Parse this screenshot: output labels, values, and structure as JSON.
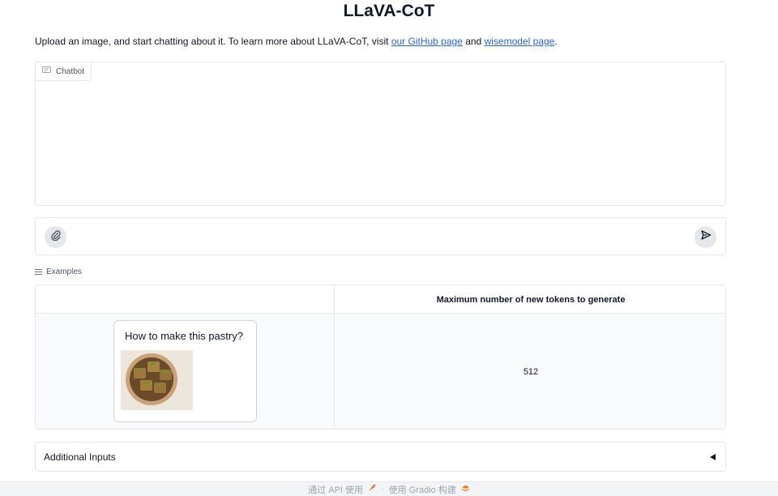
{
  "header": {
    "title": "LLaVA-CoT",
    "description_prefix": "Upload an image, and start chatting about it. To learn more about LLaVA-CoT, visit ",
    "link_github": "our GitHub page",
    "description_mid": " and ",
    "link_wisemodel": "wisemodel page",
    "description_suffix": "."
  },
  "chatbot": {
    "label": "Chatbot",
    "icon": "chat-bubble-icon"
  },
  "input": {
    "placeholder": "",
    "attach_icon": "paperclip-icon",
    "send_icon": "send-icon"
  },
  "examples": {
    "label": "Examples",
    "columns": [
      "",
      "Maximum number of new tokens to generate"
    ],
    "rows": [
      {
        "prompt": "How to make this pastry?",
        "image": "baklava-bowl-thumbnail",
        "max_tokens": "512"
      }
    ]
  },
  "additional_inputs": {
    "label": "Additional Inputs",
    "icon": "caret-left-icon"
  },
  "footer": {
    "api_text": "通过 API 使用",
    "separator": "·",
    "built_text": "使用 Gradio 构建"
  },
  "colors": {
    "link": "#2563eb",
    "border": "#e5e7eb",
    "button_bg": "#e5e7eb"
  }
}
